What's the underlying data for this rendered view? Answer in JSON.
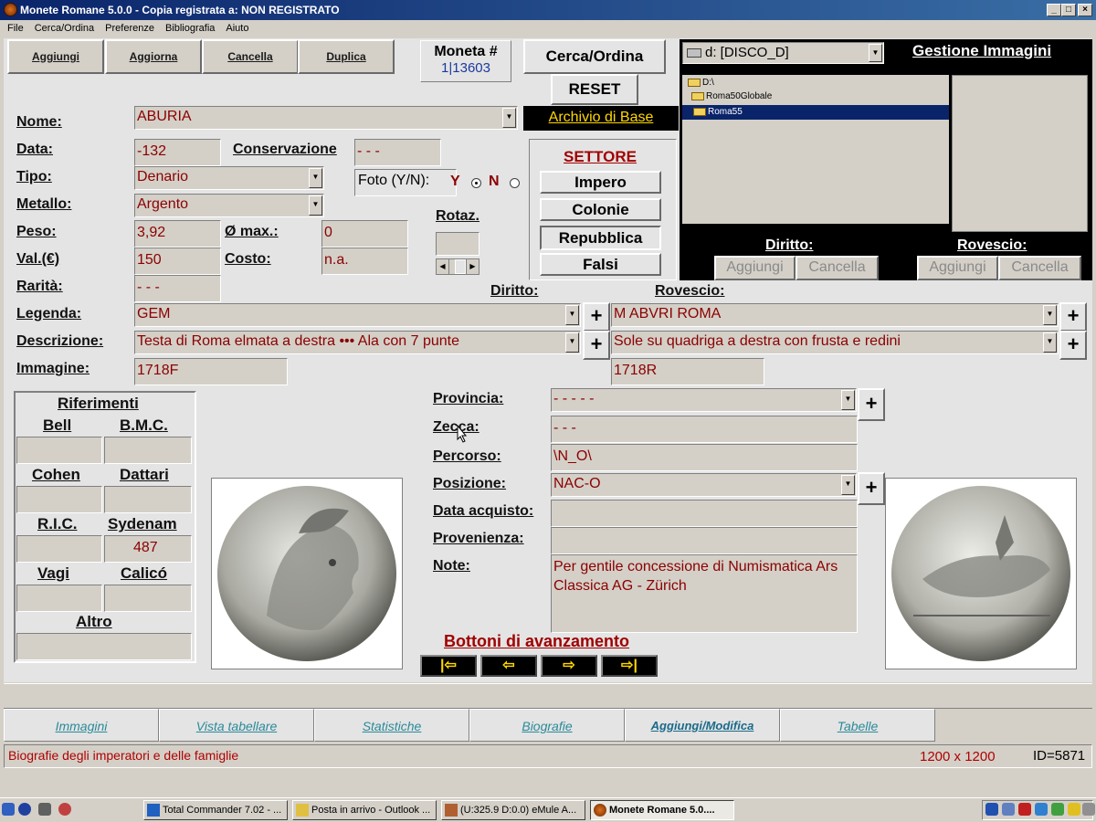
{
  "window": {
    "title": "Monete Romane 5.0.0 - Copia registrata a:  NON REGISTRATO"
  },
  "menu": [
    "File",
    "Cerca/Ordina",
    "Preferenze",
    "Bibliografia",
    "Aiuto"
  ],
  "toolbar": {
    "aggiungi": "Aggiungi",
    "aggiorna": "Aggiorna",
    "cancella": "Cancella",
    "duplica": "Duplica"
  },
  "moneta": {
    "label": "Moneta #",
    "value": "1|13603"
  },
  "actions": {
    "cerca": "Cerca/Ordina",
    "reset": "RESET",
    "archivio": "Archivio di Base"
  },
  "drive": {
    "selected": "d: [DISCO_D]"
  },
  "gestione": {
    "title": "Gestione Immagini",
    "folders": [
      "D:\\",
      "Roma50Globale",
      "Roma55"
    ]
  },
  "image_panel": {
    "diritto": "Diritto:",
    "rovescio": "Rovescio:",
    "aggiungi": "Aggiungi",
    "cancella": "Cancella"
  },
  "settore": {
    "title": "SETTORE",
    "buttons": [
      "Impero",
      "Colonie",
      "Repubblica",
      "Falsi"
    ]
  },
  "form": {
    "nome_label": "Nome:",
    "nome": "ABURIA",
    "data_label": "Data:",
    "data": "-132",
    "conservazione_label": "Conservazione",
    "conservazione": "- - -",
    "tipo_label": "Tipo:",
    "tipo": "Denario",
    "foto_label": "Foto (Y/N):",
    "foto_y": "Y",
    "foto_n": "N",
    "metallo_label": "Metallo:",
    "metallo": "Argento",
    "rotaz_label": "Rotaz.",
    "peso_label": "Peso:",
    "peso": "3,92",
    "diam_label": "Ø max.:",
    "diam": "0",
    "val_label": "Val.(€)",
    "val": "150",
    "costo_label": "Costo:",
    "costo": "n.a.",
    "rarita_label": "Rarità:",
    "rarita": "- - -",
    "diritto_label": "Diritto:",
    "rovescio_label": "Rovescio:",
    "legenda_label": "Legenda:",
    "legenda_d": "GEM",
    "legenda_r": "M ABVRI ROMA",
    "descrizione_label": "Descrizione:",
    "descr_d": "Testa di Roma elmata a destra ••• Ala con 7 punte",
    "descr_r": "Sole su quadriga a destra con frusta e redini",
    "immagine_label": "Immagine:",
    "img_d": "1718F",
    "img_r": "1718R",
    "provincia_label": "Provincia:",
    "provincia": "- - - - -",
    "zecca_label": "Zecca:",
    "zecca": "- - -",
    "percorso_label": "Percorso:",
    "percorso": "\\N_O\\",
    "posizione_label": "Posizione:",
    "posizione": "NAC-O",
    "acquisto_label": "Data acquisto:",
    "acquisto": "",
    "provenienza_label": "Provenienza:",
    "provenienza": "",
    "note_label": "Note:",
    "note": "Per gentile concessione di Numismatica Ars Classica AG - Zürich"
  },
  "riferimenti": {
    "title": "Riferimenti",
    "bell": "Bell",
    "bmc": "B.M.C.",
    "cohen": "Cohen",
    "dattari": "Dattari",
    "ric": "R.I.C.",
    "sydenam": "Sydenam",
    "sydenam_val": "487",
    "vagi": "Vagi",
    "calico": "Calicó",
    "altro": "Altro"
  },
  "avanzamento": {
    "title": "Bottoni di avanzamento",
    "buttons": [
      "|⇦",
      "⇦",
      "⇨",
      "⇨|"
    ]
  },
  "tabs": [
    "Immagini",
    "Vista tabellare",
    "Statistiche",
    "Biografie",
    "Aggiungi/Modifica",
    "Tabelle"
  ],
  "status": {
    "text": "Biografie degli imperatori e delle famiglie",
    "size": "1200 x 1200",
    "id": "ID=5871"
  },
  "taskbar": [
    "Total Commander 7.02 - ...",
    "Posta in arrivo - Outlook ...",
    "(U:325.9 D:0.0) eMule A...",
    "Monete Romane 5.0...."
  ]
}
